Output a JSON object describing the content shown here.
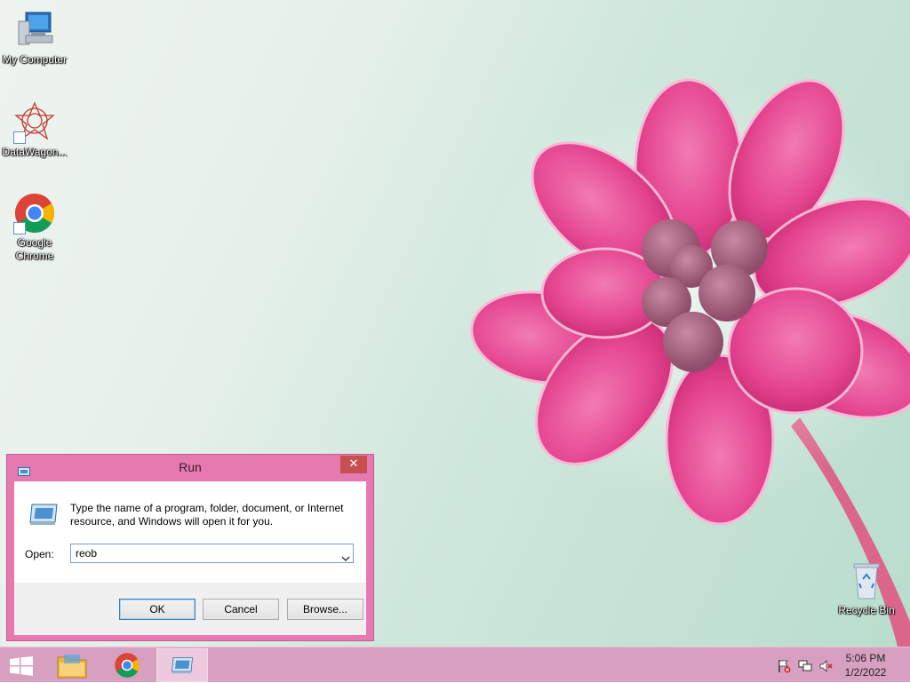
{
  "desktop": {
    "icons": [
      {
        "label": "My Computer",
        "icon": "computer-icon"
      },
      {
        "label": "DataWagon...",
        "icon": "datawagon-icon"
      },
      {
        "label": "Google Chrome",
        "icon": "chrome-icon"
      },
      {
        "label": "Recycle Bin",
        "icon": "recycle-bin-icon"
      }
    ]
  },
  "run_dialog": {
    "title": "Run",
    "close_label": "✕",
    "description": "Type the name of a program, folder, document, or Internet resource, and Windows will open it for you.",
    "open_label": "Open:",
    "open_value": "reob",
    "ok_label": "OK",
    "cancel_label": "Cancel",
    "browse_label": "Browse..."
  },
  "taskbar": {
    "items": [
      {
        "icon": "start-icon"
      },
      {
        "icon": "file-explorer-icon"
      },
      {
        "icon": "chrome-icon"
      },
      {
        "icon": "run-icon",
        "active": true
      }
    ],
    "tray": [
      "action-center-flag-icon",
      "network-icon",
      "volume-muted-icon"
    ],
    "time": "5:06 PM",
    "date": "1/2/2022"
  },
  "colors": {
    "accent": "#e67ab0",
    "taskbar": "#d7a0c0",
    "close": "#c7504f"
  }
}
